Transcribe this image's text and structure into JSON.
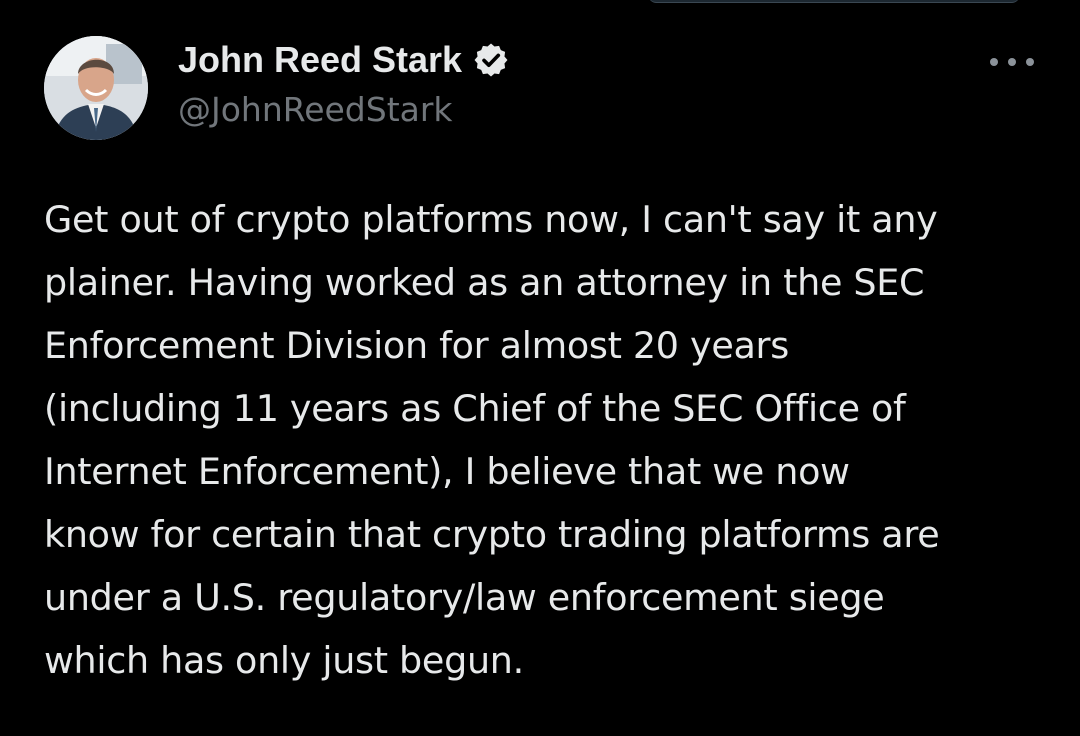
{
  "author": {
    "display_name": "John Reed Stark",
    "handle": "@JohnReedStark",
    "verified": true,
    "avatar": "profile-photo"
  },
  "tweet": {
    "lines": [
      "Get out of crypto platforms now, I can't say it any",
      "plainer. Having worked as an attorney in the SEC",
      "Enforcement Division for almost 20 years",
      "(including 11 years as Chief of the SEC Office of",
      "Internet Enforcement), I believe that we now",
      "know for certain that crypto trading platforms are",
      "under a U.S. regulatory/law enforcement siege",
      "which has only just begun."
    ]
  },
  "icons": {
    "verified": "verified-badge-icon",
    "more": "more-options-icon"
  },
  "colors": {
    "background": "#000000",
    "text_primary": "#e7e9ea",
    "text_secondary": "#71767b",
    "verified_badge": "#e7e9ea"
  }
}
